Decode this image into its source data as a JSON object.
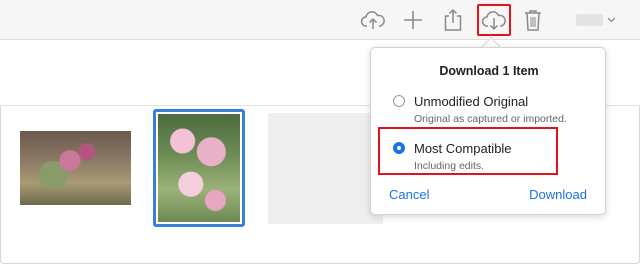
{
  "toolbar": {
    "icons": [
      "cloud-upload-icon",
      "add-icon",
      "share-icon",
      "cloud-download-icon",
      "trash-icon",
      "chevron-down-icon"
    ],
    "accent_color": "#8a8a8a",
    "highlight_color": "#e4131b"
  },
  "popover": {
    "title": "Download 1 Item",
    "options": [
      {
        "label": "Unmodified Original",
        "sublabel": "Original as captured or imported.",
        "selected": false
      },
      {
        "label": "Most Compatible",
        "sublabel": "Including edits.",
        "selected": true
      }
    ],
    "cancel_label": "Cancel",
    "download_label": "Download",
    "link_color": "#1a73e8"
  },
  "selection_color": "#3a7fd9"
}
